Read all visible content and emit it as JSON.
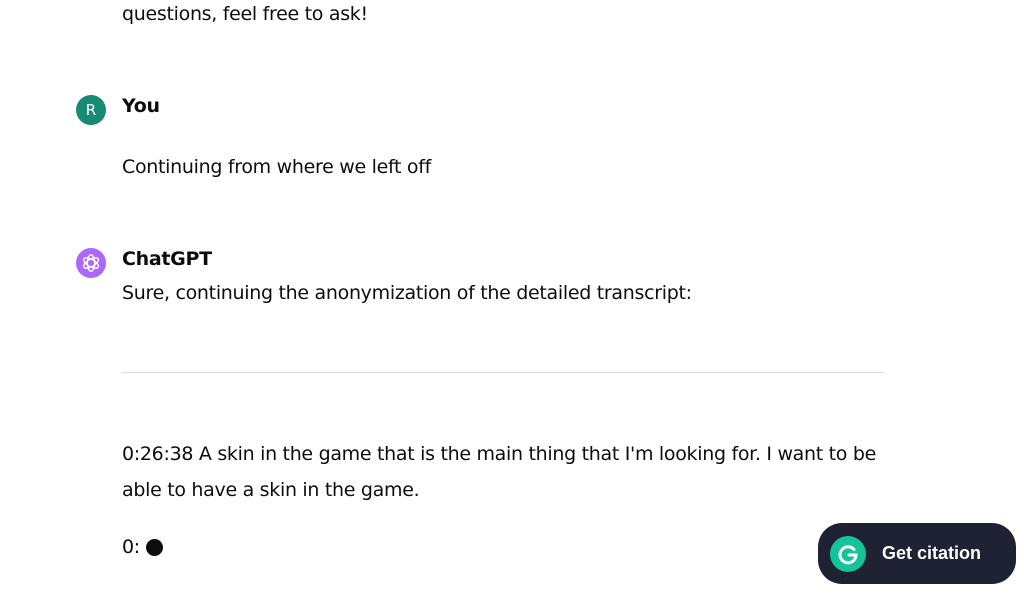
{
  "conversation": {
    "previous_text": "questions, feel free to ask!",
    "user_message": {
      "avatar_letter": "R",
      "author": "You",
      "text": "Continuing from where we left off"
    },
    "assistant_message": {
      "author": "ChatGPT",
      "intro": "Sure, continuing the anonymization of the detailed transcript:",
      "transcript_line": "0:26:38 A skin in the game that is the main thing that I'm looking for. I want to be able to have a skin in the game.",
      "partial_line": "0:"
    }
  },
  "grammarly": {
    "label": "Get citation",
    "icon": "grammarly-icon"
  },
  "colors": {
    "user_avatar": "#168a73",
    "assistant_avatar": "#ab68ff",
    "citation_bg": "#1f2233",
    "grammarly_green": "#15c39a"
  }
}
